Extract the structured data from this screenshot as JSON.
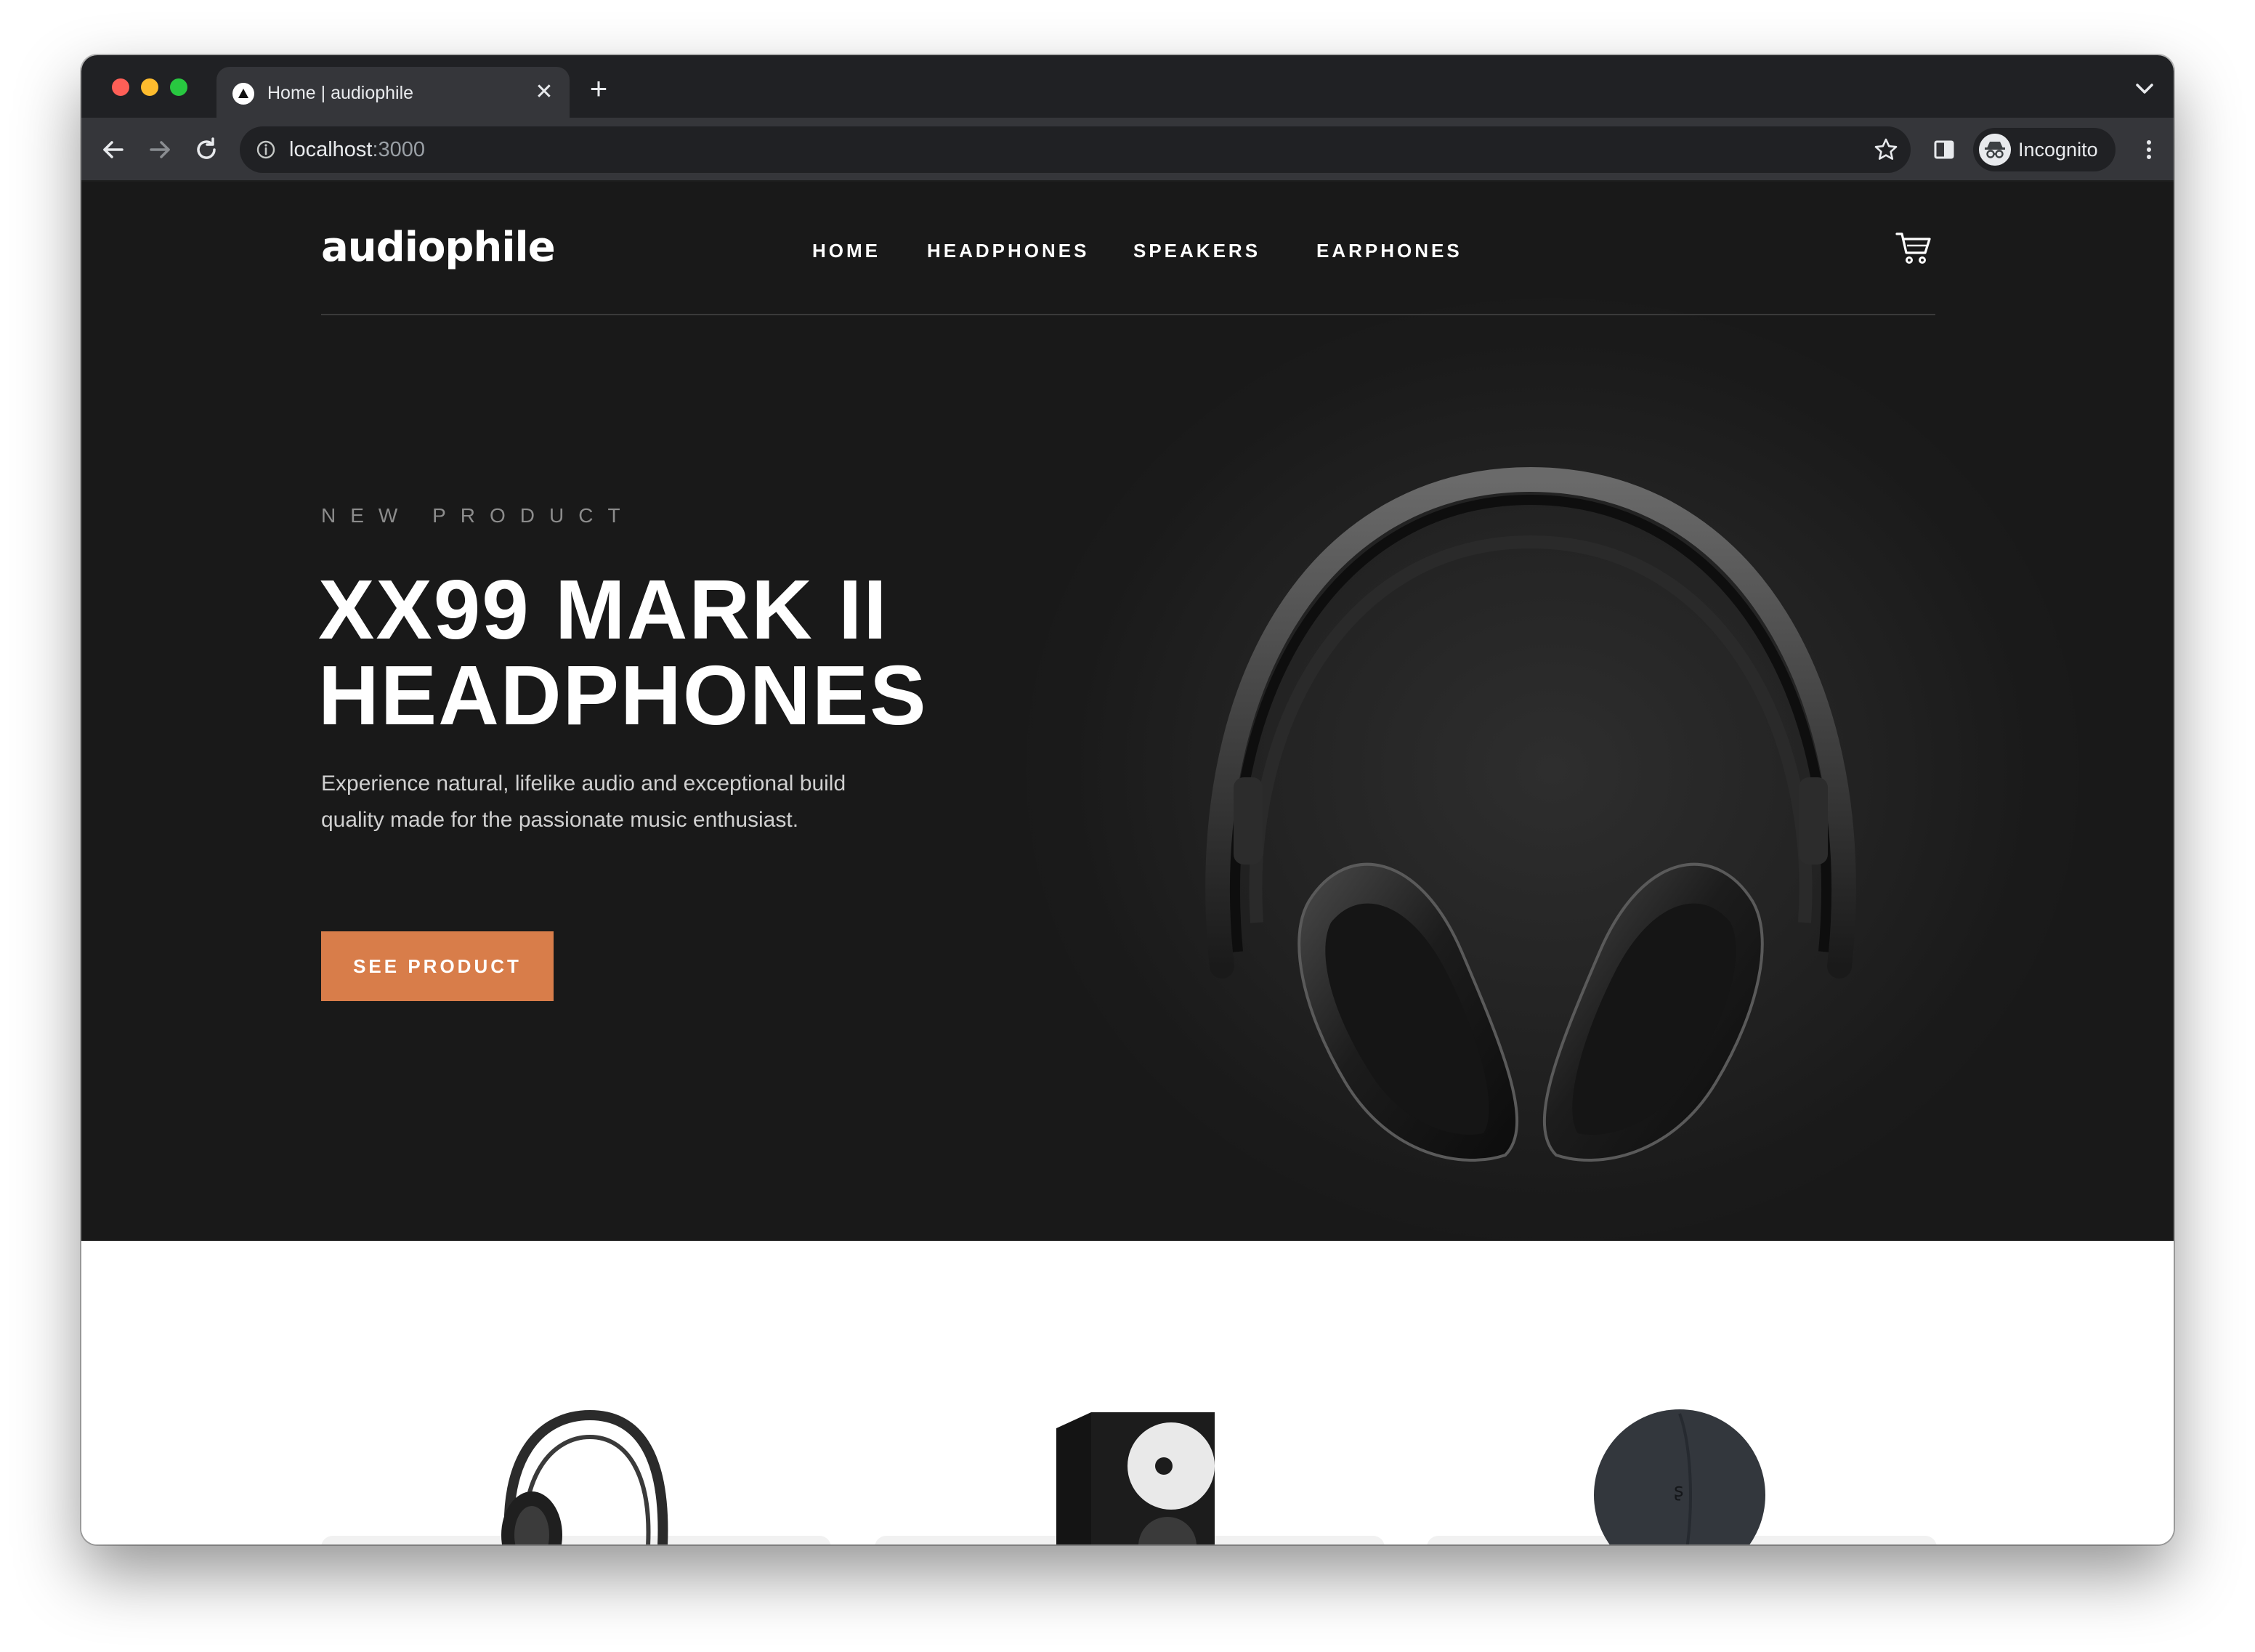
{
  "browser": {
    "tab_title": "Home | audiophile",
    "url_host": "localhost",
    "url_port": ":3000",
    "profile_label": "Incognito"
  },
  "site": {
    "logo": "audiophile",
    "nav": [
      "HOME",
      "HEADPHONES",
      "SPEAKERS",
      "EARPHONES"
    ]
  },
  "hero": {
    "overline": "NEW PRODUCT",
    "title_line1": "XX99 Mark II",
    "title_line2": "Headphones",
    "description": "Experience natural, lifelike audio and exceptional build quality made for the passionate music enthusiast.",
    "cta": "SEE PRODUCT"
  },
  "colors": {
    "accent": "#d87d4a",
    "hero_bg": "#191919",
    "browser_chrome": "#202124"
  },
  "icons": [
    "info-icon",
    "star-icon",
    "cart-icon",
    "back-arrow-icon",
    "forward-arrow-icon",
    "reload-icon"
  ]
}
